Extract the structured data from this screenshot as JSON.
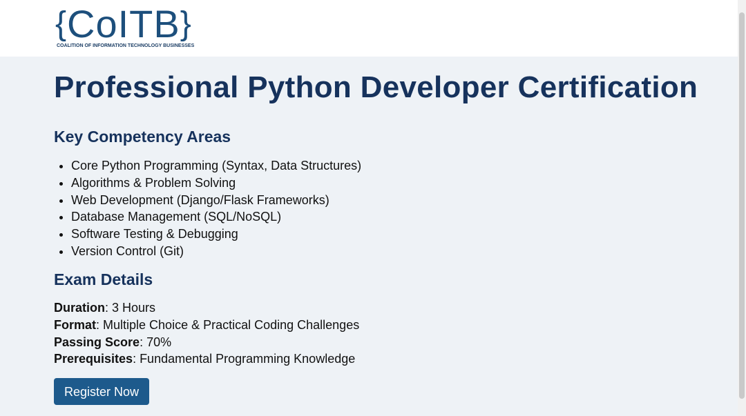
{
  "logo": {
    "brace_open": "{",
    "text": "CoITB",
    "brace_close": "}",
    "tagline": "COALITION OF INFORMATION TECHNOLOGY BUSINESSES"
  },
  "page_title": "Professional Python Developer Certification",
  "competencies": {
    "heading": "Key Competency Areas",
    "items": [
      "Core Python Programming (Syntax, Data Structures)",
      "Algorithms & Problem Solving",
      "Web Development (Django/Flask Frameworks)",
      "Database Management (SQL/NoSQL)",
      "Software Testing & Debugging",
      "Version Control (Git)"
    ]
  },
  "exam": {
    "heading": "Exam Details",
    "rows": [
      {
        "label": "Duration",
        "value": ": 3 Hours"
      },
      {
        "label": "Format",
        "value": ": Multiple Choice & Practical Coding Challenges"
      },
      {
        "label": "Passing Score",
        "value": ": 70%"
      },
      {
        "label": "Prerequisites",
        "value": ": Fundamental Programming Knowledge"
      }
    ]
  },
  "register_label": "Register Now",
  "colors": {
    "brand": "#1d4f7c",
    "heading": "#16325c",
    "button": "#1d5a8c",
    "background": "#eef2f6"
  }
}
